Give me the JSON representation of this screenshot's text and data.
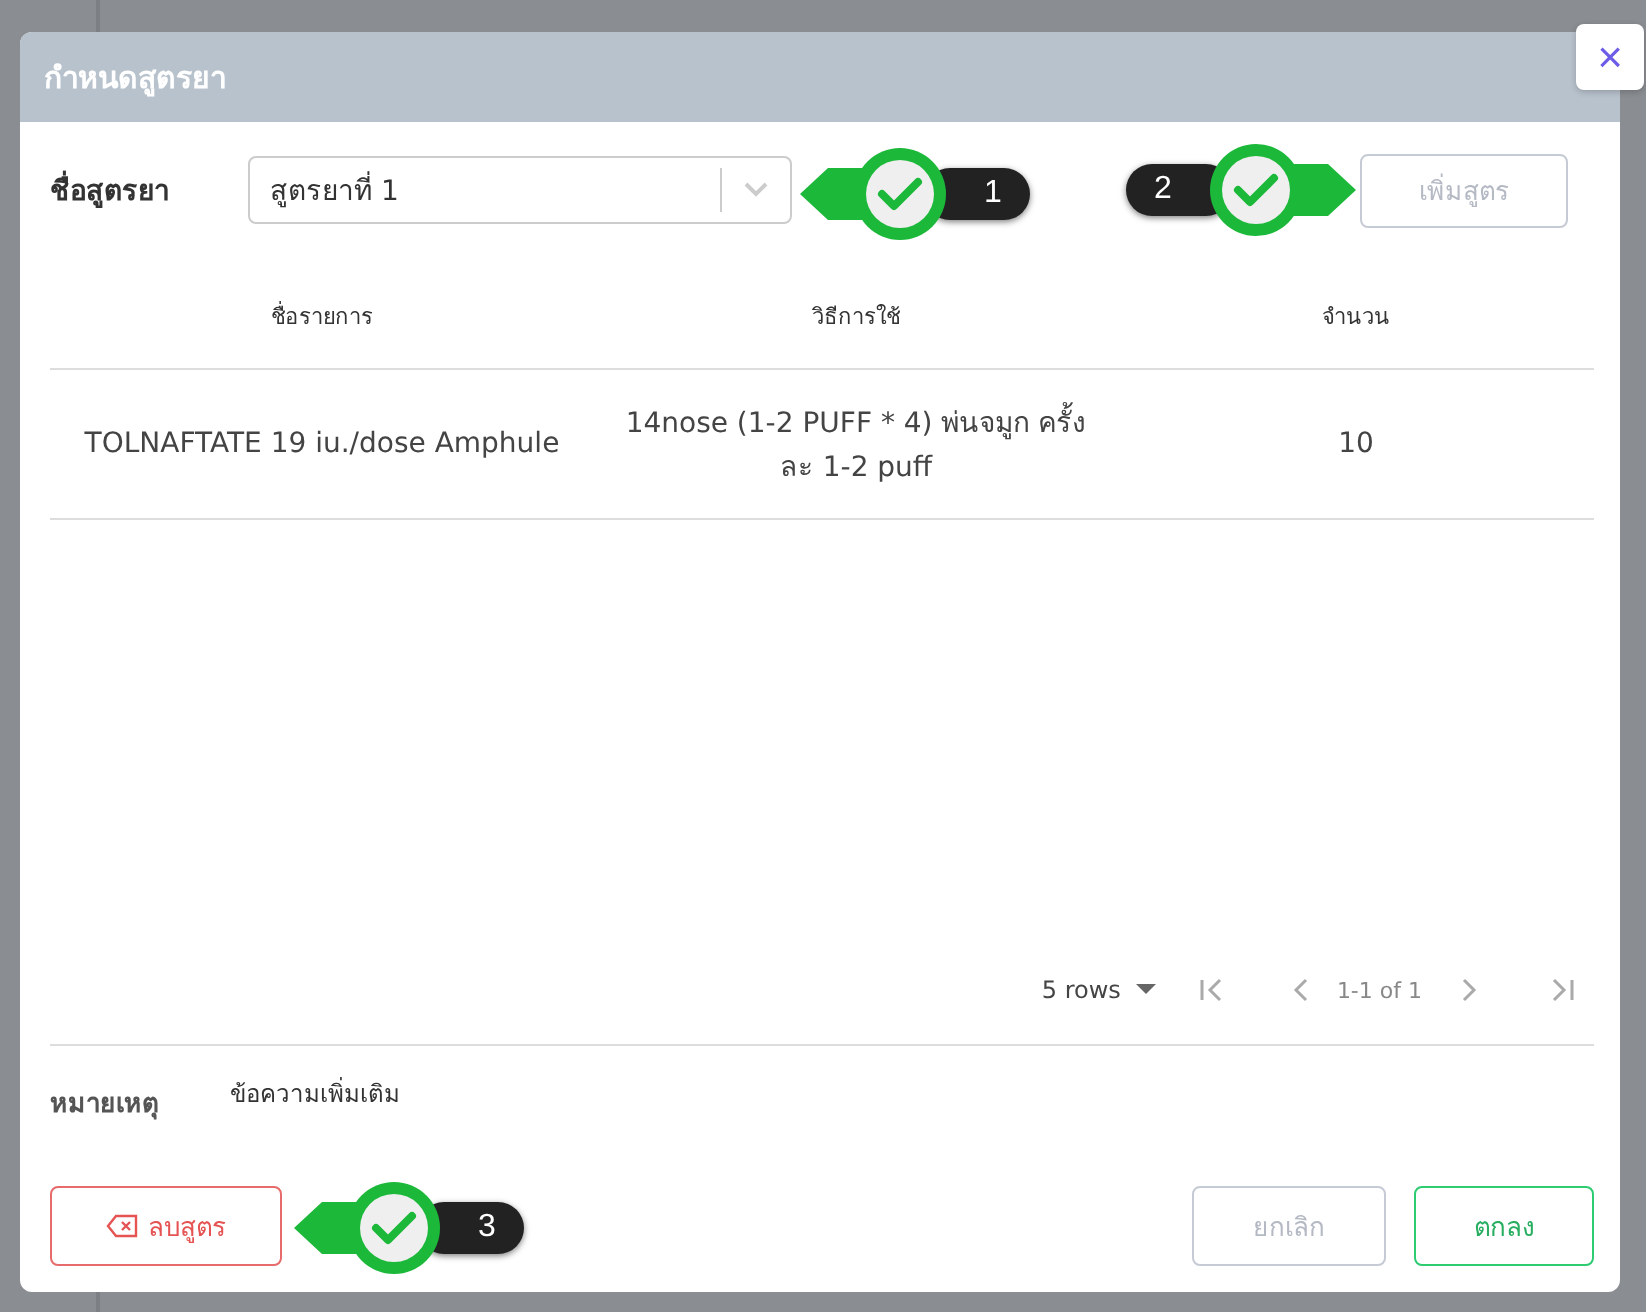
{
  "dialog": {
    "title": "กำหนดสูตรยา",
    "close_label": "×"
  },
  "formula": {
    "label": "ชื่อสูตรยา",
    "value": "สูตรยาที่ 1"
  },
  "add_button": {
    "label": "เพิ่มสูตร",
    "disabled": true
  },
  "table": {
    "columns": [
      "ชื่อรายการ",
      "วิธีการใช้",
      "จำนวน"
    ],
    "rows": [
      [
        "TOLNAFTATE 19 iu./dose Amphule",
        "14nose (1-2 PUFF * 4) พ่นจมูก ครั้งละ 1-2 puff",
        "10"
      ]
    ]
  },
  "pagination": {
    "rows_per_page": "5 rows",
    "range": "1-1 of 1"
  },
  "remark": {
    "label": "หมายเหตุ",
    "value": "ข้อความเพิ่มเติม"
  },
  "buttons": [
    {
      "kind": "delete",
      "label": "ลบสูตร",
      "disabled": false
    },
    {
      "kind": "cancel",
      "label": "ยกเลิก",
      "disabled": true
    },
    {
      "kind": "ok",
      "label": "ตกลง",
      "disabled": false
    }
  ],
  "callouts": [
    {
      "number": "1",
      "kind": "left"
    },
    {
      "number": "2",
      "kind": "right"
    },
    {
      "number": "3",
      "kind": "left"
    }
  ]
}
